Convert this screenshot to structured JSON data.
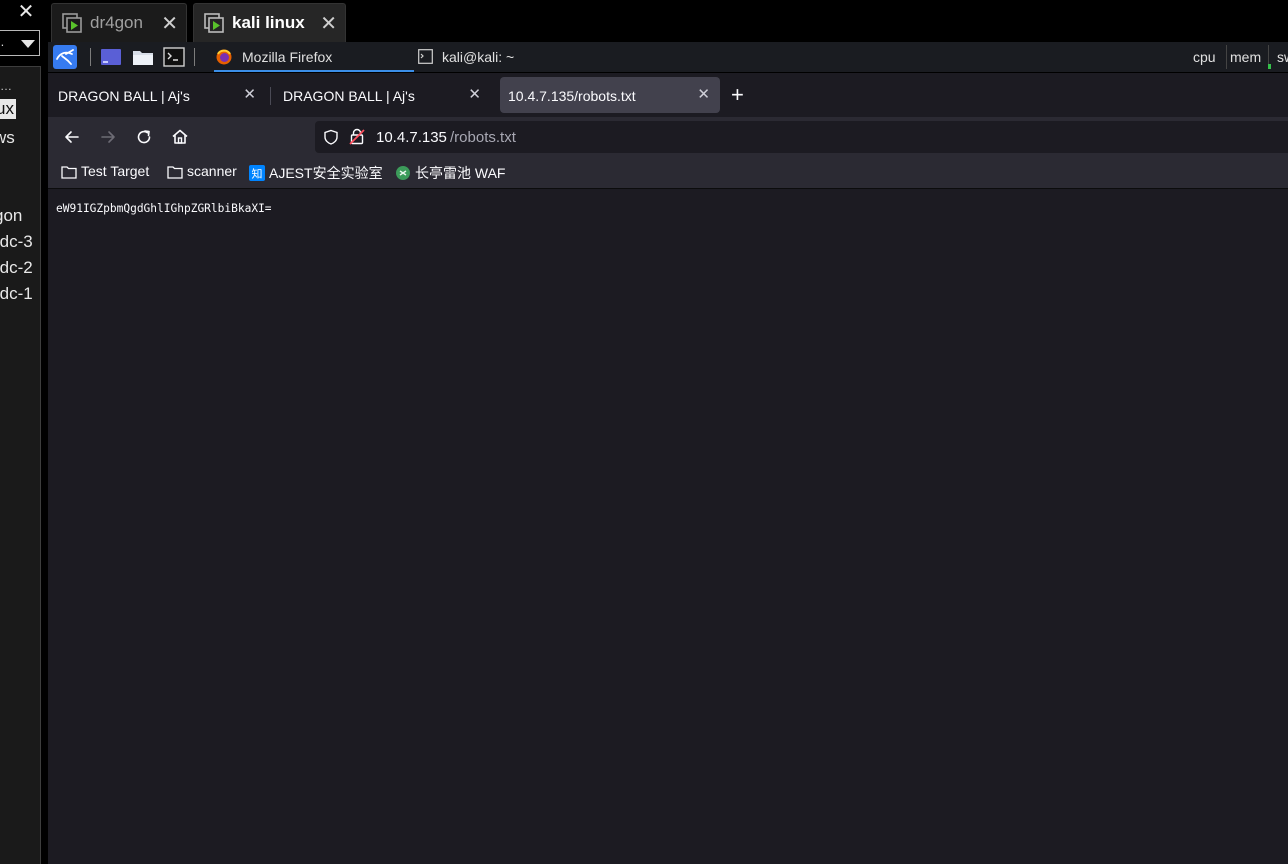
{
  "left_panel": {
    "close_glyph": "✕",
    "select_value": "..",
    "items": [
      {
        "label": "…",
        "selected": false
      },
      {
        "label": "ux",
        "selected": true
      },
      {
        "label": "ws",
        "selected": false
      },
      {
        "label": "gon",
        "selected": false
      },
      {
        "label": "-dc-3",
        "selected": false
      },
      {
        "label": "-dc-2",
        "selected": false
      },
      {
        "label": "-dc-1",
        "selected": false
      }
    ]
  },
  "host_tabs": [
    {
      "label": "dr4gon",
      "active": false,
      "icon": "vm-icon"
    },
    {
      "label": "kali linux",
      "active": true,
      "icon": "vm-icon"
    }
  ],
  "kali_panel": {
    "launchers": [
      "kali-menu-icon",
      "workspace-icon",
      "files-icon",
      "terminal-icon"
    ],
    "tasks": [
      {
        "label": "Mozilla Firefox",
        "icon": "firefox-icon",
        "active": true
      },
      {
        "label": "kali@kali: ~",
        "icon": "terminal-icon",
        "active": false
      }
    ],
    "monitors": [
      "cpu",
      "mem",
      "sw"
    ]
  },
  "firefox": {
    "tabs": [
      {
        "label": "DRAGON BALL | Aj's",
        "active": false
      },
      {
        "label": "DRAGON BALL | Aj's",
        "active": false
      },
      {
        "label": "10.4.7.135/robots.txt",
        "active": true
      }
    ],
    "close_glyph": "✕",
    "new_tab_glyph": "+",
    "url": {
      "host": "10.4.7.135",
      "path": "/robots.txt"
    },
    "bookmarks": [
      {
        "label": "Test Target",
        "icon": "folder-icon"
      },
      {
        "label": "scanner",
        "icon": "folder-icon"
      },
      {
        "label": "AJEST安全实验室",
        "icon": "zhihu-icon"
      },
      {
        "label": "长亭雷池 WAF",
        "icon": "chaitin-icon"
      }
    ],
    "content_text": "eW91IGZpbmQgdGhlIGhpZGRlbiBkaXI="
  },
  "colors": {
    "firefox_tab_bar": "#1c1b22",
    "firefox_toolbar": "#2b2a33",
    "active_tab": "#42414d",
    "accent_blue": "#3b8ee8",
    "vm_green": "#59c22b"
  }
}
